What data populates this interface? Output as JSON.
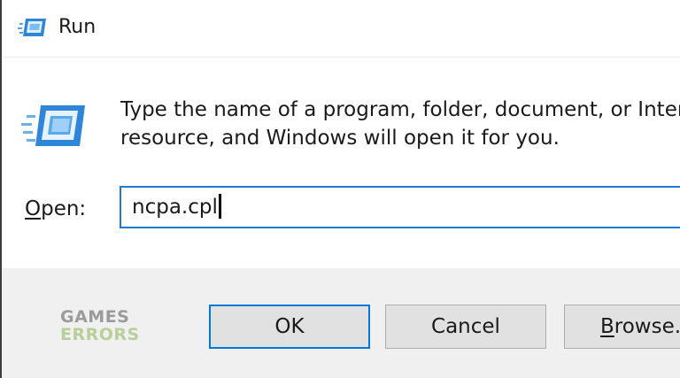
{
  "window": {
    "title": "Run",
    "title_icon": "run-icon"
  },
  "dialog": {
    "icon": "run-icon",
    "description_line1": "Type the name of a program, folder, document, or Internet",
    "description_line2": "resource, and Windows will open it for you."
  },
  "open_field": {
    "label_accel": "O",
    "label_rest": "pen:",
    "value": "ncpa.cpl"
  },
  "buttons": {
    "ok_label": "OK",
    "cancel_label": "Cancel",
    "browse_accel": "B",
    "browse_rest": "rowse..."
  },
  "watermark": {
    "line1": "GAMES",
    "line2": "ERRORS"
  },
  "colors": {
    "accent": "#0078d7",
    "footer_bg": "#f0f0f0",
    "button_bg": "#e1e1e1"
  }
}
